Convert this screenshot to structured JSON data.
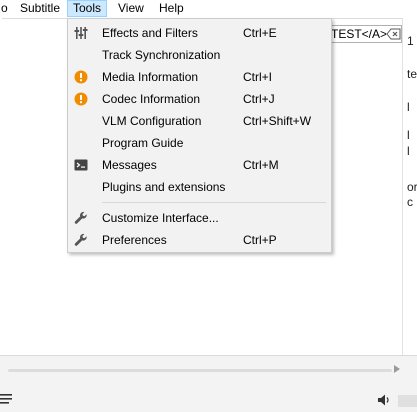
{
  "menubar": {
    "items": [
      {
        "label": "o"
      },
      {
        "label": "Subtitle"
      },
      {
        "label": "Tools"
      },
      {
        "label": "View"
      },
      {
        "label": "Help"
      }
    ]
  },
  "background": {
    "field_text": "TEST</A>",
    "fragments": [
      "1",
      "te",
      "l",
      "l",
      "l",
      "l",
      "or",
      "c"
    ]
  },
  "tools_menu": {
    "items": [
      {
        "label": "Effects and Filters",
        "shortcut": "Ctrl+E",
        "icon": "equalizer-sliders-icon"
      },
      {
        "label": "Track Synchronization",
        "shortcut": "",
        "icon": ""
      },
      {
        "label": "Media Information",
        "shortcut": "Ctrl+I",
        "icon": "info-orange-icon"
      },
      {
        "label": "Codec Information",
        "shortcut": "Ctrl+J",
        "icon": "info-orange-icon"
      },
      {
        "label": "VLM Configuration",
        "shortcut": "Ctrl+Shift+W",
        "icon": ""
      },
      {
        "label": "Program Guide",
        "shortcut": "",
        "icon": ""
      },
      {
        "label": "Messages",
        "shortcut": "Ctrl+M",
        "icon": "terminal-icon"
      },
      {
        "label": "Plugins and extensions",
        "shortcut": "",
        "icon": ""
      },
      {
        "label": "Customize Interface...",
        "shortcut": "",
        "icon": "wrench-icon"
      },
      {
        "label": "Preferences",
        "shortcut": "Ctrl+P",
        "icon": "wrench-icon"
      }
    ]
  },
  "colors": {
    "menu_active_bg": "#cce8ff",
    "menu_active_border": "#99d1ff",
    "dropdown_bg": "#f2f2f2",
    "info_icon": "#f08c00"
  }
}
